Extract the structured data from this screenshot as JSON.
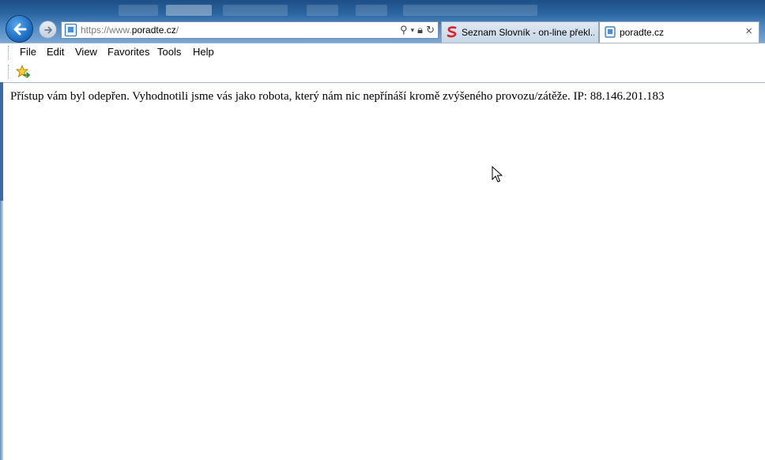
{
  "address_bar": {
    "url_prefix": "https://www.",
    "url_host": "poradte.cz",
    "url_suffix": "/"
  },
  "tabs": [
    {
      "label": "Seznam Slovník - on-line překl...",
      "active": false,
      "icon": "seznam-s-icon"
    },
    {
      "label": "poradte.cz",
      "active": true,
      "icon": "page-icon",
      "close_label": "×"
    }
  ],
  "menu": {
    "items": [
      "File",
      "Edit",
      "View",
      "Favorites",
      "Tools",
      "Help"
    ]
  },
  "page": {
    "message": "Přístup vám byl odepřen. Vyhodnotili jsme vás jako robota, který nám nic nepřínáší kromě zvýšeného provozu/zátěže. IP: 88.146.201.183"
  },
  "colors": {
    "chrome_blue": "#2a64a0",
    "back_button": "#1f6fc4",
    "seznam_red": "#d8232a"
  }
}
